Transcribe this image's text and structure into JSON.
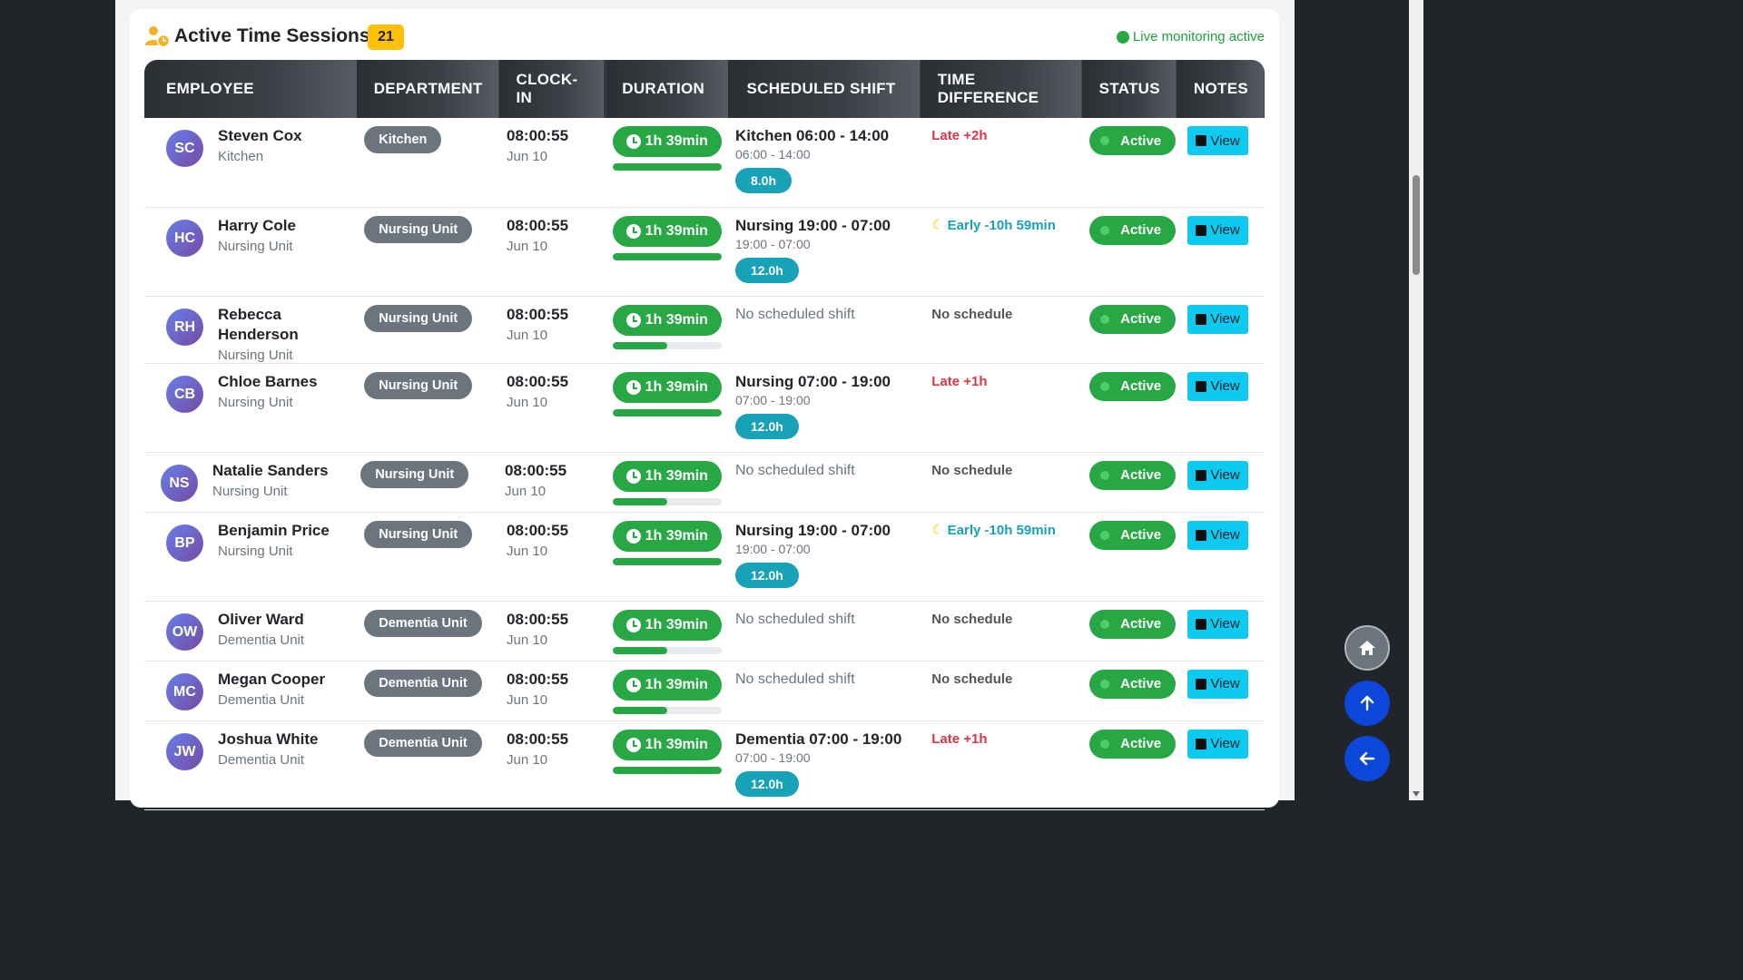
{
  "header": {
    "title": "Active Time Sessions",
    "count": "21",
    "live_text": "Live monitoring active"
  },
  "columns": [
    "EMPLOYEE",
    "DEPARTMENT",
    "CLOCK-IN",
    "DURATION",
    "SCHEDULED SHIFT",
    "TIME DIFFERENCE",
    "STATUS",
    "NOTES"
  ],
  "rows": [
    {
      "initials": "SC",
      "name": "Steven Cox",
      "dept": "Kitchen",
      "clock_in": "08:00:55",
      "date": "Jun 10",
      "duration": "1h 39min",
      "progress": 1.0,
      "shift_name": "Kitchen 06:00 - 14:00",
      "shift_times": "06:00 - 14:00",
      "shift_hours": "8.0h",
      "no_shift": "",
      "diff": "Late +2h",
      "diff_type": "late",
      "status": "Active",
      "notes": "View"
    },
    {
      "initials": "HC",
      "name": "Harry Cole",
      "dept": "Nursing Unit",
      "clock_in": "08:00:55",
      "date": "Jun 10",
      "duration": "1h 39min",
      "progress": 1.0,
      "shift_name": "Nursing 19:00 - 07:00",
      "shift_times": "19:00 - 07:00",
      "shift_hours": "12.0h",
      "no_shift": "",
      "diff": "Early -10h 59min",
      "diff_type": "early",
      "status": "Active",
      "notes": "View"
    },
    {
      "initials": "RH",
      "name": "Rebecca Henderson",
      "dept": "Nursing Unit",
      "clock_in": "08:00:55",
      "date": "Jun 10",
      "duration": "1h 39min",
      "progress": 0.5,
      "shift_name": "",
      "shift_times": "",
      "shift_hours": "",
      "no_shift": "No scheduled shift",
      "diff": "No schedule",
      "diff_type": "nosched",
      "status": "Active",
      "notes": "View"
    },
    {
      "initials": "CB",
      "name": "Chloe Barnes",
      "dept": "Nursing Unit",
      "clock_in": "08:00:55",
      "date": "Jun 10",
      "duration": "1h 39min",
      "progress": 1.0,
      "shift_name": "Nursing 07:00 - 19:00",
      "shift_times": "07:00 - 19:00",
      "shift_hours": "12.0h",
      "no_shift": "",
      "diff": "Late +1h",
      "diff_type": "late",
      "status": "Active",
      "notes": "View"
    },
    {
      "initials": "NS",
      "name": "Natalie Sanders",
      "dept": "Nursing Unit",
      "clock_in": "08:00:55",
      "date": "Jun 10",
      "duration": "1h 39min",
      "progress": 0.5,
      "shift_name": "",
      "shift_times": "",
      "shift_hours": "",
      "no_shift": "No scheduled shift",
      "diff": "No schedule",
      "diff_type": "nosched",
      "status": "Active",
      "notes": "View"
    },
    {
      "initials": "BP",
      "name": "Benjamin Price",
      "dept": "Nursing Unit",
      "clock_in": "08:00:55",
      "date": "Jun 10",
      "duration": "1h 39min",
      "progress": 1.0,
      "shift_name": "Nursing 19:00 - 07:00",
      "shift_times": "19:00 - 07:00",
      "shift_hours": "12.0h",
      "no_shift": "",
      "diff": "Early -10h 59min",
      "diff_type": "early",
      "status": "Active",
      "notes": "View"
    },
    {
      "initials": "OW",
      "name": "Oliver Ward",
      "dept": "Dementia Unit",
      "clock_in": "08:00:55",
      "date": "Jun 10",
      "duration": "1h 39min",
      "progress": 0.5,
      "shift_name": "",
      "shift_times": "",
      "shift_hours": "",
      "no_shift": "No scheduled shift",
      "diff": "No schedule",
      "diff_type": "nosched",
      "status": "Active",
      "notes": "View"
    },
    {
      "initials": "MC",
      "name": "Megan Cooper",
      "dept": "Dementia Unit",
      "clock_in": "08:00:55",
      "date": "Jun 10",
      "duration": "1h 39min",
      "progress": 0.5,
      "shift_name": "",
      "shift_times": "",
      "shift_hours": "",
      "no_shift": "No scheduled shift",
      "diff": "No schedule",
      "diff_type": "nosched",
      "status": "Active",
      "notes": "View"
    },
    {
      "initials": "JW",
      "name": "Joshua White",
      "dept": "Dementia Unit",
      "clock_in": "08:00:55",
      "date": "Jun 10",
      "duration": "1h 39min",
      "progress": 1.0,
      "shift_name": "Dementia 07:00 - 19:00",
      "shift_times": "07:00 - 19:00",
      "shift_hours": "12.0h",
      "no_shift": "",
      "diff": "Late +1h",
      "diff_type": "late",
      "status": "Active",
      "notes": "View"
    }
  ],
  "fab": {
    "home_icon": "home-icon",
    "up_icon": "arrow-up-icon",
    "back_icon": "arrow-left-icon"
  },
  "colors": {
    "accent_green": "#28a745",
    "badge_yellow": "#ffc107",
    "info_cyan": "#17a2b8",
    "late_red": "#dc3545"
  }
}
